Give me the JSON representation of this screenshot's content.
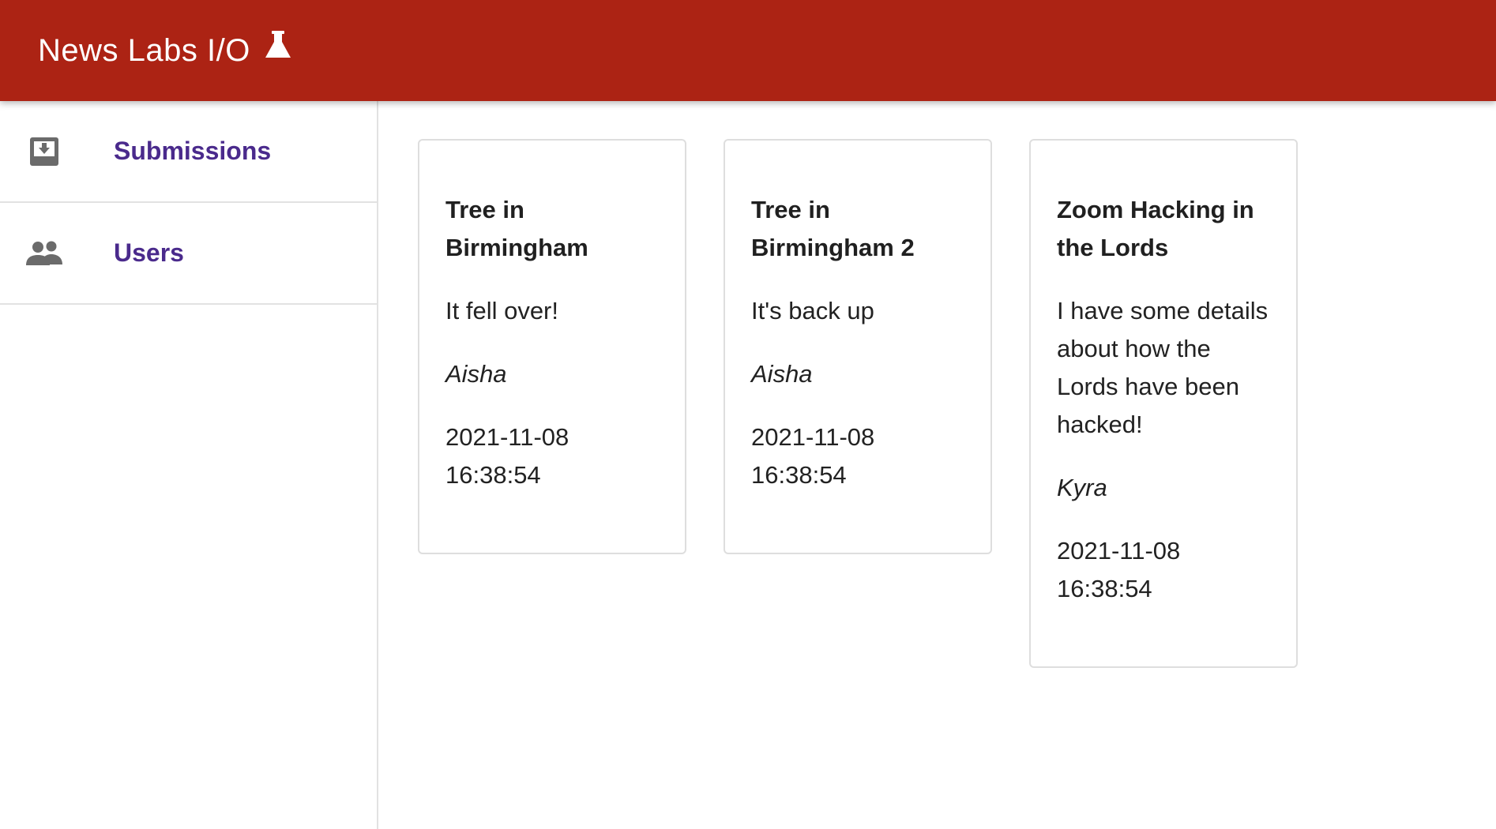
{
  "app": {
    "title": "News Labs I/O",
    "brand_color": "#ac2314",
    "icon": "flask-icon"
  },
  "sidebar": {
    "items": [
      {
        "label": "Submissions",
        "icon": "inbox-download-icon"
      },
      {
        "label": "Users",
        "icon": "people-icon"
      }
    ]
  },
  "submissions": [
    {
      "title": "Tree in Birmingham",
      "body": "It fell over!",
      "author": "Aisha",
      "date": "2021-11-08",
      "time": "16:38:54"
    },
    {
      "title": "Tree in Birmingham 2",
      "body": "It's back up",
      "author": "Aisha",
      "date": "2021-11-08",
      "time": "16:38:54"
    },
    {
      "title": "Zoom Hacking in the Lords",
      "body": "I have some details about how the Lords have been hacked!",
      "author": "Kyra",
      "date": "2021-11-08",
      "time": "16:38:54"
    }
  ]
}
